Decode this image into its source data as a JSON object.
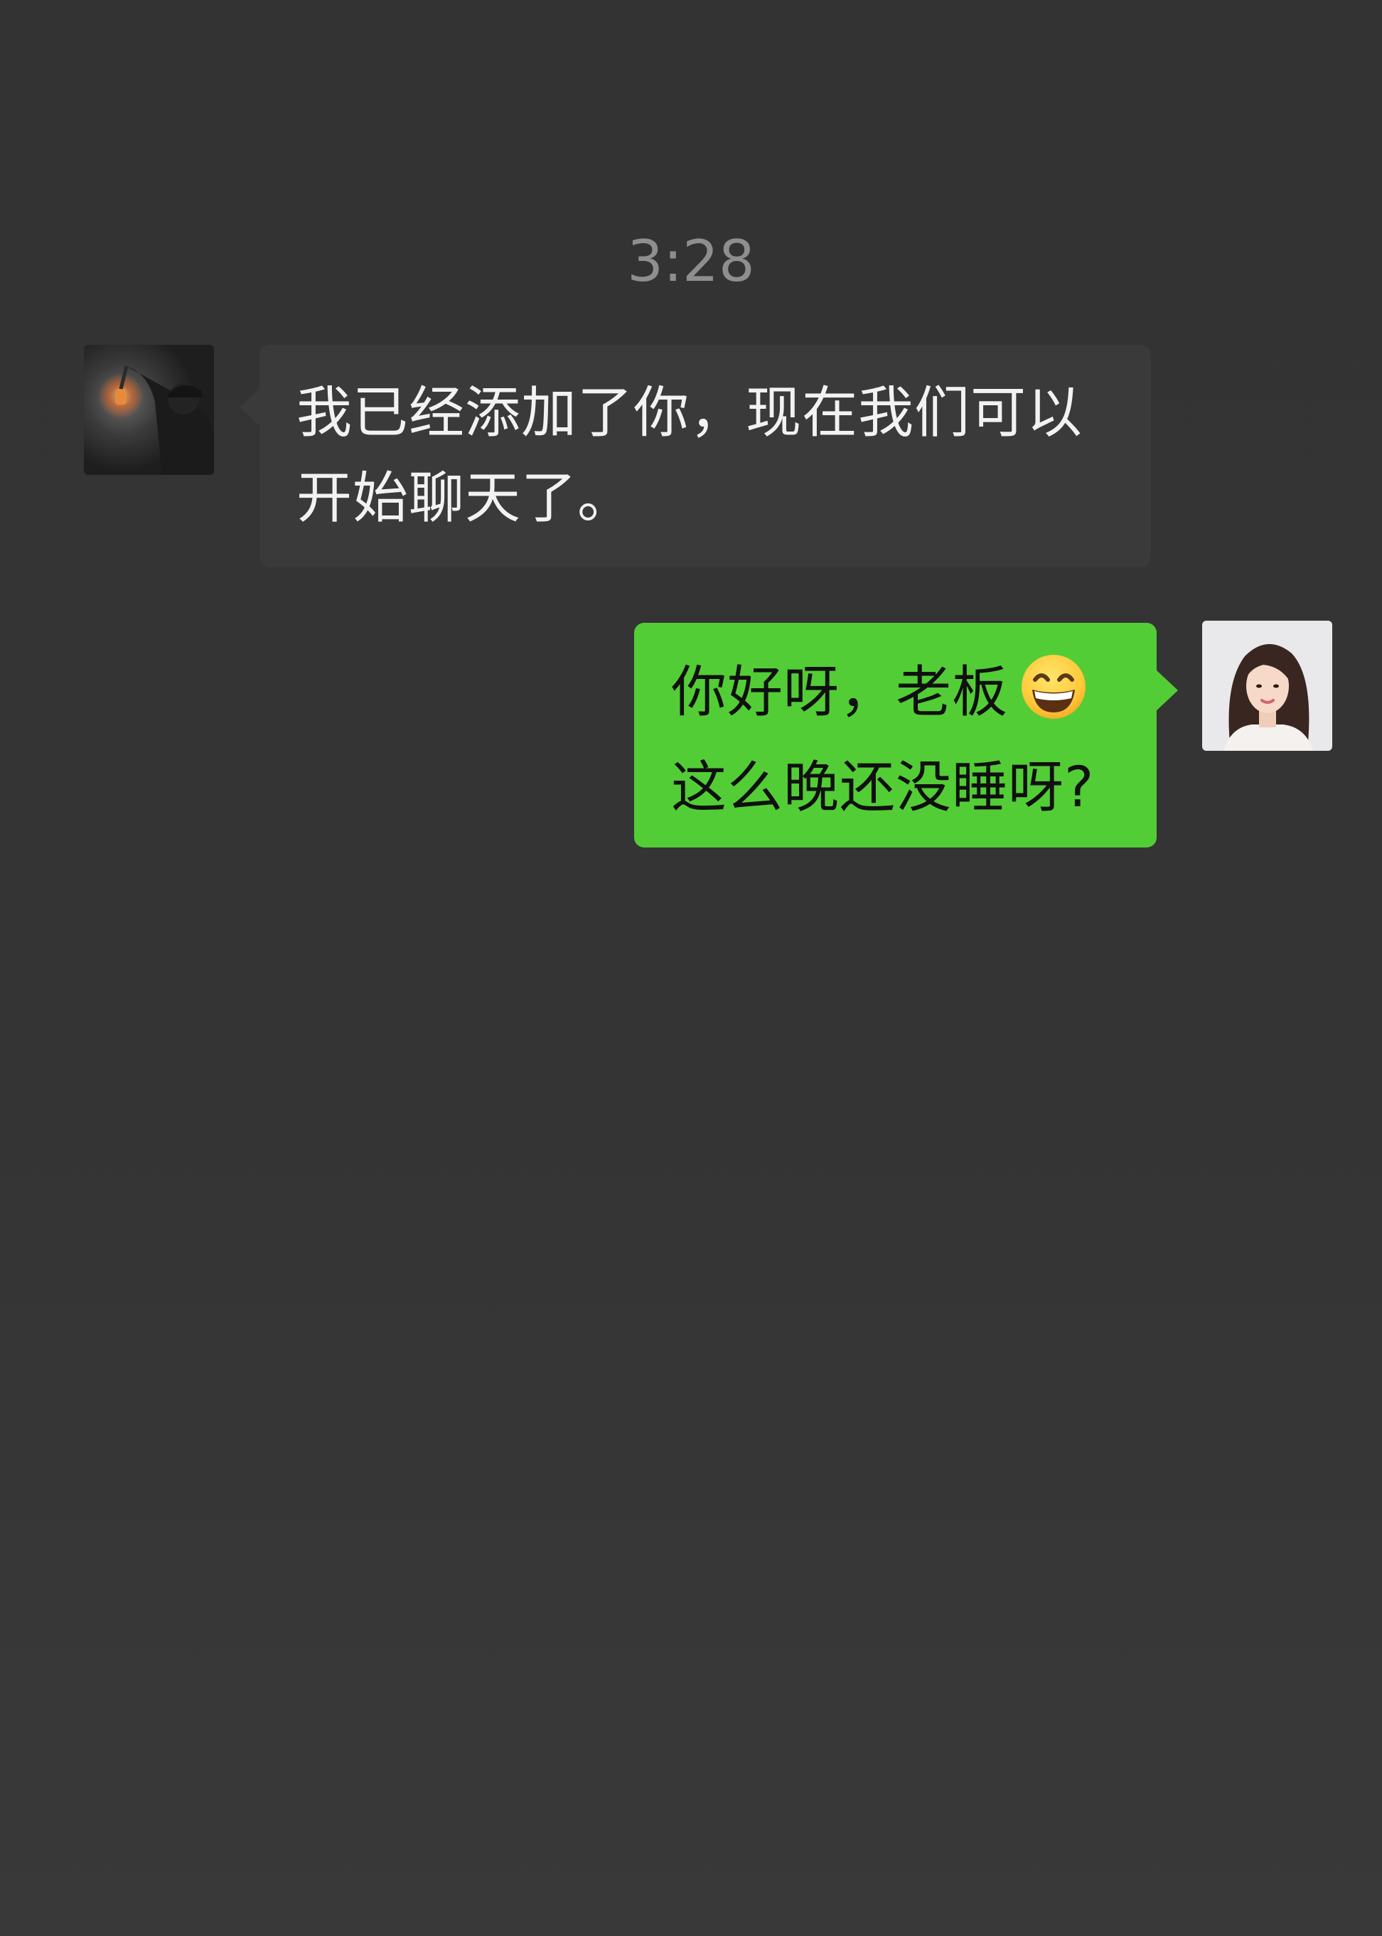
{
  "chat": {
    "timestamp": "3:28",
    "messages": [
      {
        "direction": "incoming",
        "lines": [
          "我已经添加了你，现在我们可以",
          "开始聊天了。"
        ],
        "bubble_color": "#3a3a3a",
        "text_color": "#f2f2f2",
        "avatar_icon": "man-with-lantern-avatar"
      },
      {
        "direction": "outgoing",
        "lines": [
          "你好呀，老板",
          "这么晚还没睡呀?"
        ],
        "emoji": "grinning-face-emoji",
        "bubble_color": "#52cd36",
        "text_color": "#101010",
        "avatar_icon": "woman-portrait-avatar"
      }
    ]
  },
  "colors": {
    "background": "#333333",
    "timestamp": "#8e8e8e"
  }
}
